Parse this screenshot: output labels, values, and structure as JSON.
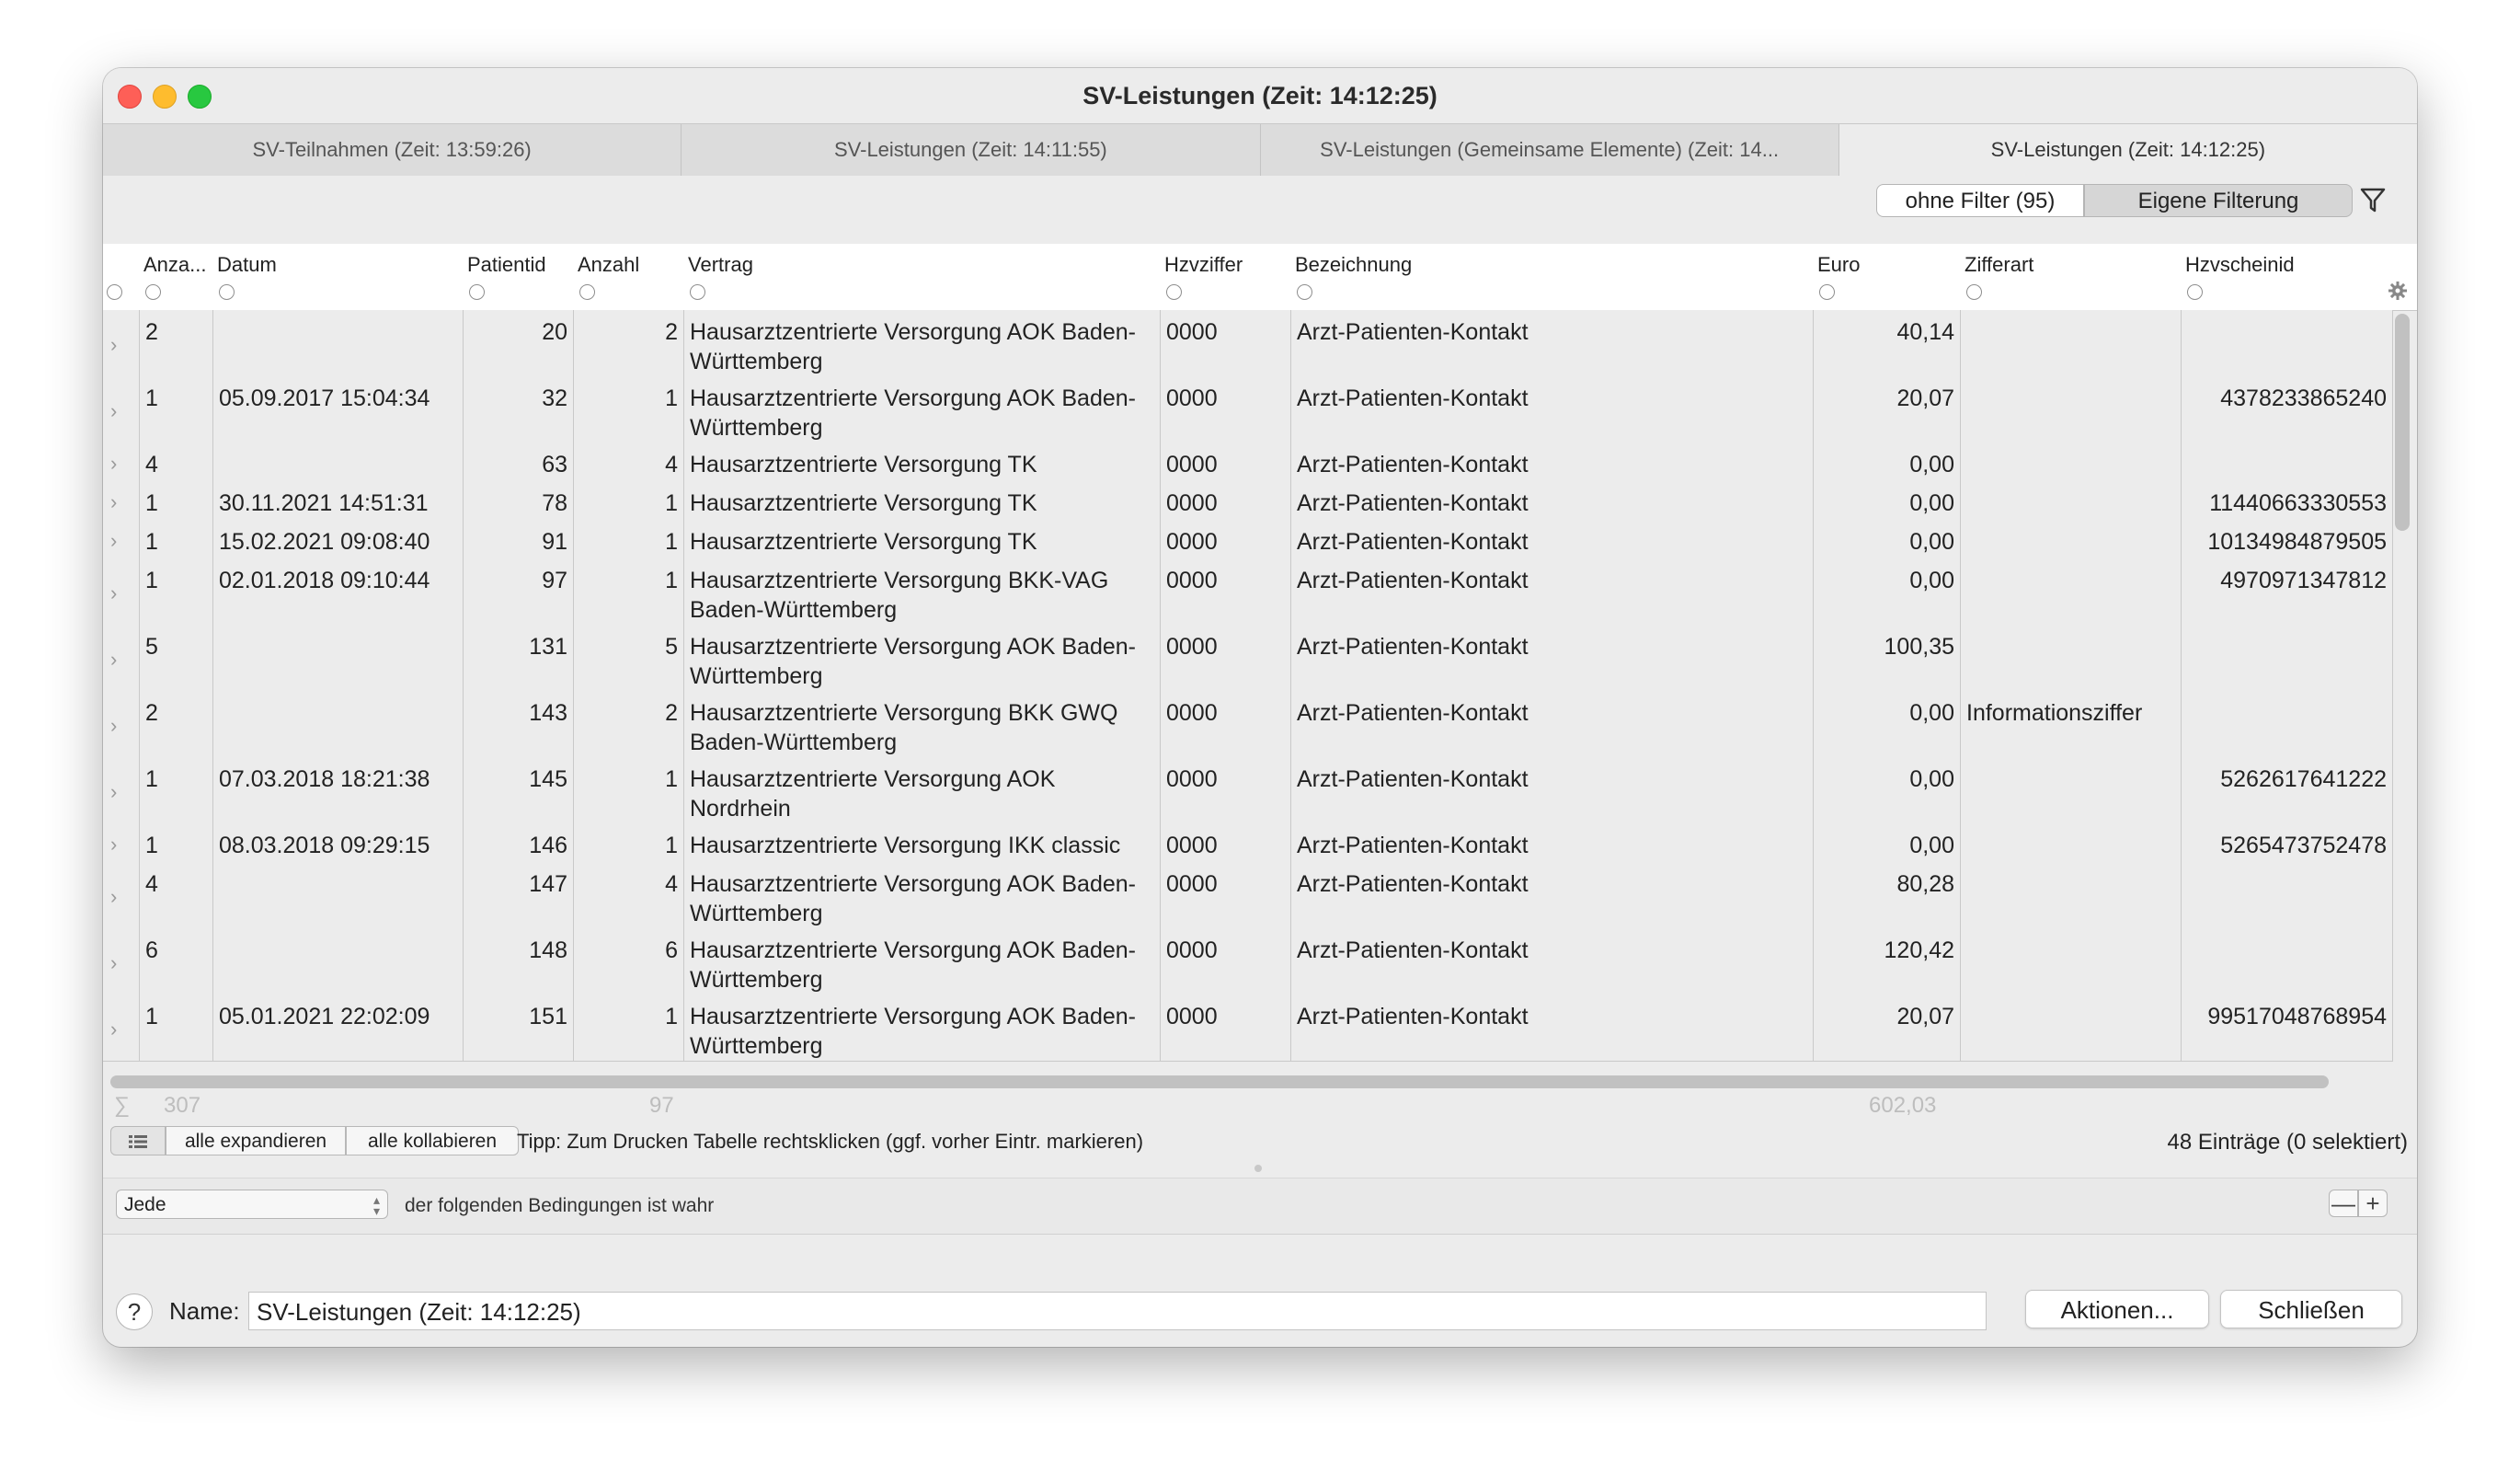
{
  "window": {
    "title": "SV-Leistungen  (Zeit: 14:12:25)"
  },
  "tabs": [
    {
      "label": "SV-Teilnahmen  (Zeit: 13:59:26)",
      "active": false
    },
    {
      "label": "SV-Leistungen  (Zeit: 14:11:55)",
      "active": false
    },
    {
      "label": "SV-Leistungen (Gemeinsame Elemente) (Zeit: 14...",
      "active": false
    },
    {
      "label": "SV-Leistungen  (Zeit: 14:12:25)",
      "active": true
    }
  ],
  "filter": {
    "without_label": "ohne Filter (95)",
    "own_label": "Eigene Filterung",
    "icon": "funnel-icon"
  },
  "columns": [
    "Anza...",
    "Datum",
    "Patientid",
    "Anzahl",
    "Vertrag",
    "Hzvziffer",
    "Bezeichnung",
    "Euro",
    "Zifferart",
    "Hzvscheinid"
  ],
  "rows": [
    {
      "anz": "2",
      "datum": "",
      "patientid": "20",
      "anzahl": "2",
      "vertrag": "Hausarztzentrierte Versorgung AOK Baden-Württemberg",
      "hzv": "0000",
      "bez": "Arzt-Patienten-Kontakt",
      "euro": "40,14",
      "zifferart": "",
      "schein": ""
    },
    {
      "anz": "1",
      "datum": "05.09.2017 15:04:34",
      "patientid": "32",
      "anzahl": "1",
      "vertrag": "Hausarztzentrierte Versorgung AOK Baden-Württemberg",
      "hzv": "0000",
      "bez": "Arzt-Patienten-Kontakt",
      "euro": "20,07",
      "zifferart": "",
      "schein": "4378233865240"
    },
    {
      "anz": "4",
      "datum": "",
      "patientid": "63",
      "anzahl": "4",
      "vertrag": "Hausarztzentrierte Versorgung TK",
      "hzv": "0000",
      "bez": "Arzt-Patienten-Kontakt",
      "euro": "0,00",
      "zifferart": "",
      "schein": ""
    },
    {
      "anz": "1",
      "datum": "30.11.2021 14:51:31",
      "patientid": "78",
      "anzahl": "1",
      "vertrag": "Hausarztzentrierte Versorgung TK",
      "hzv": "0000",
      "bez": "Arzt-Patienten-Kontakt",
      "euro": "0,00",
      "zifferart": "",
      "schein": "11440663330553"
    },
    {
      "anz": "1",
      "datum": "15.02.2021 09:08:40",
      "patientid": "91",
      "anzahl": "1",
      "vertrag": "Hausarztzentrierte Versorgung TK",
      "hzv": "0000",
      "bez": "Arzt-Patienten-Kontakt",
      "euro": "0,00",
      "zifferart": "",
      "schein": "10134984879505"
    },
    {
      "anz": "1",
      "datum": "02.01.2018 09:10:44",
      "patientid": "97",
      "anzahl": "1",
      "vertrag": "Hausarztzentrierte Versorgung BKK-VAG Baden-Württemberg",
      "hzv": "0000",
      "bez": "Arzt-Patienten-Kontakt",
      "euro": "0,00",
      "zifferart": "",
      "schein": "4970971347812"
    },
    {
      "anz": "5",
      "datum": "",
      "patientid": "131",
      "anzahl": "5",
      "vertrag": "Hausarztzentrierte Versorgung AOK Baden-Württemberg",
      "hzv": "0000",
      "bez": "Arzt-Patienten-Kontakt",
      "euro": "100,35",
      "zifferart": "",
      "schein": ""
    },
    {
      "anz": "2",
      "datum": "",
      "patientid": "143",
      "anzahl": "2",
      "vertrag": "Hausarztzentrierte Versorgung BKK GWQ Baden-Württemberg",
      "hzv": "0000",
      "bez": "Arzt-Patienten-Kontakt",
      "euro": "0,00",
      "zifferart": "Informationsziffer",
      "schein": ""
    },
    {
      "anz": "1",
      "datum": "07.03.2018 18:21:38",
      "patientid": "145",
      "anzahl": "1",
      "vertrag": "Hausarztzentrierte Versorgung AOK Nordrhein",
      "hzv": "0000",
      "bez": "Arzt-Patienten-Kontakt",
      "euro": "0,00",
      "zifferart": "",
      "schein": "5262617641222"
    },
    {
      "anz": "1",
      "datum": "08.03.2018 09:29:15",
      "patientid": "146",
      "anzahl": "1",
      "vertrag": "Hausarztzentrierte Versorgung IKK classic",
      "hzv": "0000",
      "bez": "Arzt-Patienten-Kontakt",
      "euro": "0,00",
      "zifferart": "",
      "schein": "5265473752478"
    },
    {
      "anz": "4",
      "datum": "",
      "patientid": "147",
      "anzahl": "4",
      "vertrag": "Hausarztzentrierte Versorgung AOK Baden-Württemberg",
      "hzv": "0000",
      "bez": "Arzt-Patienten-Kontakt",
      "euro": "80,28",
      "zifferart": "",
      "schein": ""
    },
    {
      "anz": "6",
      "datum": "",
      "patientid": "148",
      "anzahl": "6",
      "vertrag": "Hausarztzentrierte Versorgung AOK Baden-Württemberg",
      "hzv": "0000",
      "bez": "Arzt-Patienten-Kontakt",
      "euro": "120,42",
      "zifferart": "",
      "schein": ""
    },
    {
      "anz": "1",
      "datum": "05.01.2021 22:02:09",
      "patientid": "151",
      "anzahl": "1",
      "vertrag": "Hausarztzentrierte Versorgung AOK Baden-Württemberg",
      "hzv": "0000",
      "bez": "Arzt-Patienten-Kontakt",
      "euro": "20,07",
      "zifferart": "",
      "schein": "99517048768954"
    }
  ],
  "sums": {
    "symbol": "∑",
    "anz": "307",
    "anzahl": "97",
    "euro": "602,03"
  },
  "toolbar": {
    "expand_label": "alle expandieren",
    "collapse_label": "alle kollabieren",
    "tip": "Tipp: Zum Drucken Tabelle rechtsklicken (ggf. vorher Eintr. markieren)",
    "count": "48 Einträge (0 selektiert)"
  },
  "condition": {
    "select_value": "Jede",
    "text": "der folgenden Bedingungen ist wahr",
    "minus": "—",
    "plus": "+"
  },
  "bottom": {
    "help": "?",
    "name_label": "Name:",
    "name_value": "SV-Leistungen  (Zeit: 14:12:25)",
    "actions_label": "Aktionen...",
    "close_label": "Schließen"
  }
}
